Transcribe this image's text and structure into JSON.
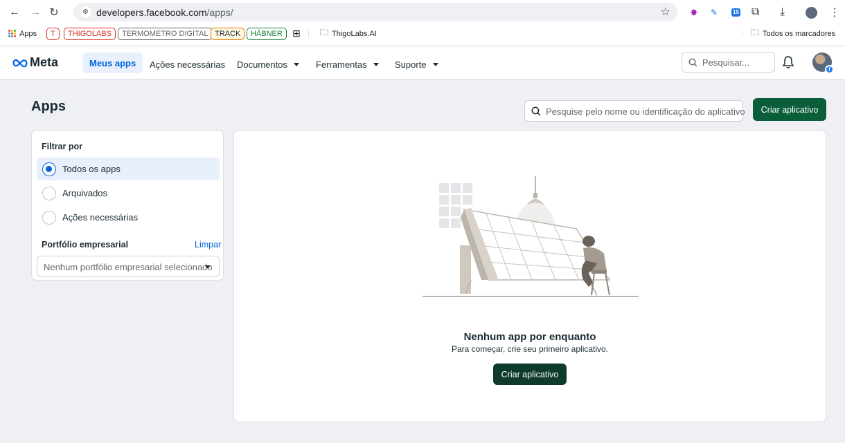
{
  "browser": {
    "url_host": "developers.facebook.com",
    "url_path": "/apps/",
    "extension_badge": "15",
    "bookmarks": [
      {
        "label": "Apps",
        "color": "#5f6368"
      },
      {
        "label": "T",
        "color": "#d93025"
      },
      {
        "label": "THIGOLABS",
        "color": "#d93025"
      },
      {
        "label": "TERMOMETRO DIGITAL",
        "color": "#5f6368"
      },
      {
        "label": "TRACK",
        "color": "#e37400"
      },
      {
        "label": "HÁBNER",
        "color": "#188038"
      },
      {
        "label": "ThigoLabs.AI",
        "color": "#202124"
      }
    ],
    "all_bookmarks_label": "Todos os marcadores"
  },
  "header": {
    "logo": "Meta",
    "nav": [
      {
        "label": "Meus apps",
        "active": true
      },
      {
        "label": "Ações necessárias"
      },
      {
        "label": "Documentos",
        "dropdown": true
      },
      {
        "label": "Ferramentas",
        "dropdown": true
      },
      {
        "label": "Suporte",
        "dropdown": true
      }
    ],
    "search_placeholder": "Pesquisar...",
    "avatar_badge": "f"
  },
  "main": {
    "title": "Apps",
    "search_placeholder": "Pesquise pelo nome ou identificação do aplicativo",
    "create_button": "Criar aplicativo",
    "filter": {
      "title": "Filtrar por",
      "options": [
        {
          "label": "Todos os apps",
          "selected": true
        },
        {
          "label": "Arquivados",
          "selected": false
        },
        {
          "label": "Ações necessárias",
          "selected": false
        }
      ],
      "portfolio_title": "Portfólio empresarial",
      "clear_label": "Limpar",
      "portfolio_placeholder": "Nenhum portfólio empresarial selecionado"
    },
    "empty_state": {
      "title": "Nenhum app por enquanto",
      "subtitle": "Para começar, crie seu primeiro aplicativo.",
      "button": "Criar aplicativo"
    }
  },
  "colors": {
    "accent": "#0064e0",
    "primary_button": "#0b5e3a",
    "empty_button": "#0e3b2a"
  }
}
